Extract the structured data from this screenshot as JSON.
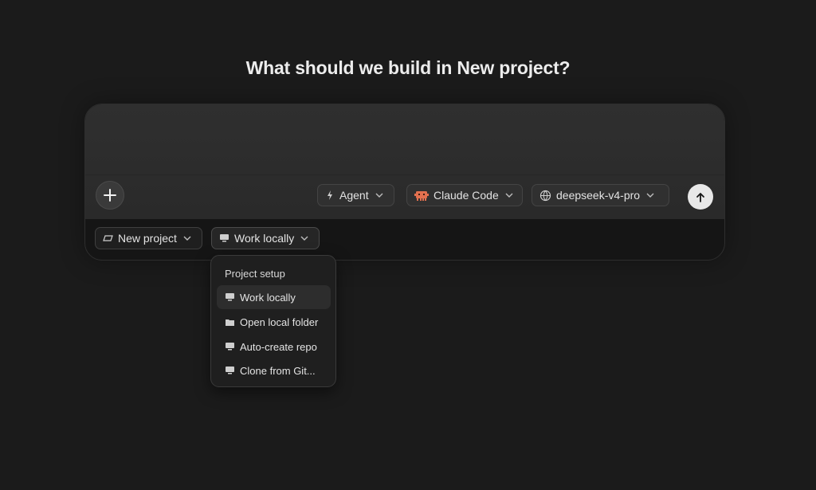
{
  "heading": "What should we build in New project?",
  "composer": {
    "prompt_placeholder": "",
    "add_label": "+",
    "mode": {
      "label": "Agent",
      "icon": "agent-sparkle-icon"
    },
    "engine": {
      "label": "Claude Code",
      "icon": "claude-code-icon"
    },
    "model": {
      "label": "deepseek-v4-pro",
      "icon": "model-globe-icon"
    },
    "send_icon": "arrow-up-icon"
  },
  "context_bar": {
    "project": {
      "label": "New project",
      "icon": "project-icon"
    },
    "location": {
      "label": "Work locally",
      "icon": "monitor-icon"
    }
  },
  "dropdown": {
    "header": "Project setup",
    "items": [
      {
        "label": "Work locally",
        "icon": "monitor-icon",
        "active": true
      },
      {
        "label": "Open local folder",
        "icon": "folder-icon",
        "active": false
      },
      {
        "label": "Auto-create repo",
        "icon": "monitor-icon",
        "active": false
      },
      {
        "label": "Clone from Git...",
        "icon": "monitor-icon",
        "active": false
      }
    ]
  },
  "colors": {
    "background": "#1b1b1b",
    "composer_top": "#2f2f2f",
    "send_button": "#e8e8e8",
    "claude_accent": "#e2704f"
  }
}
